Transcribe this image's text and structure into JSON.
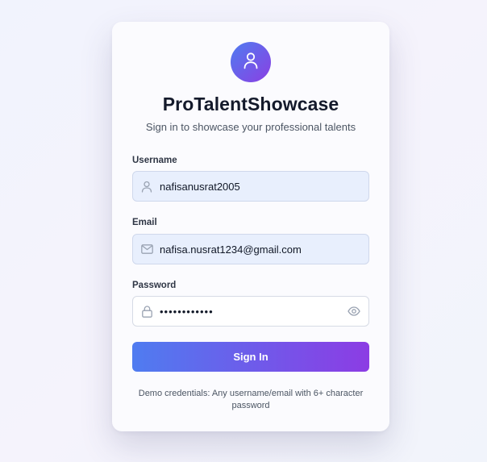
{
  "app": {
    "title": "ProTalentShowcase",
    "subtitle": "Sign in to showcase your professional talents"
  },
  "form": {
    "username": {
      "label": "Username",
      "value": "nafisanusrat2005",
      "icon": "user-icon"
    },
    "email": {
      "label": "Email",
      "value": "nafisa.nusrat1234@gmail.com",
      "icon": "mail-icon"
    },
    "password": {
      "label": "Password",
      "value": "••••••••••••",
      "icon": "lock-icon",
      "toggle_icon": "eye-icon"
    },
    "submit_label": "Sign In"
  },
  "note": "Demo credentials: Any username/email with 6+ character password",
  "colors": {
    "accent_start": "#4f7cf0",
    "accent_end": "#8c3ce4",
    "filled_field_bg": "#e8effd"
  }
}
